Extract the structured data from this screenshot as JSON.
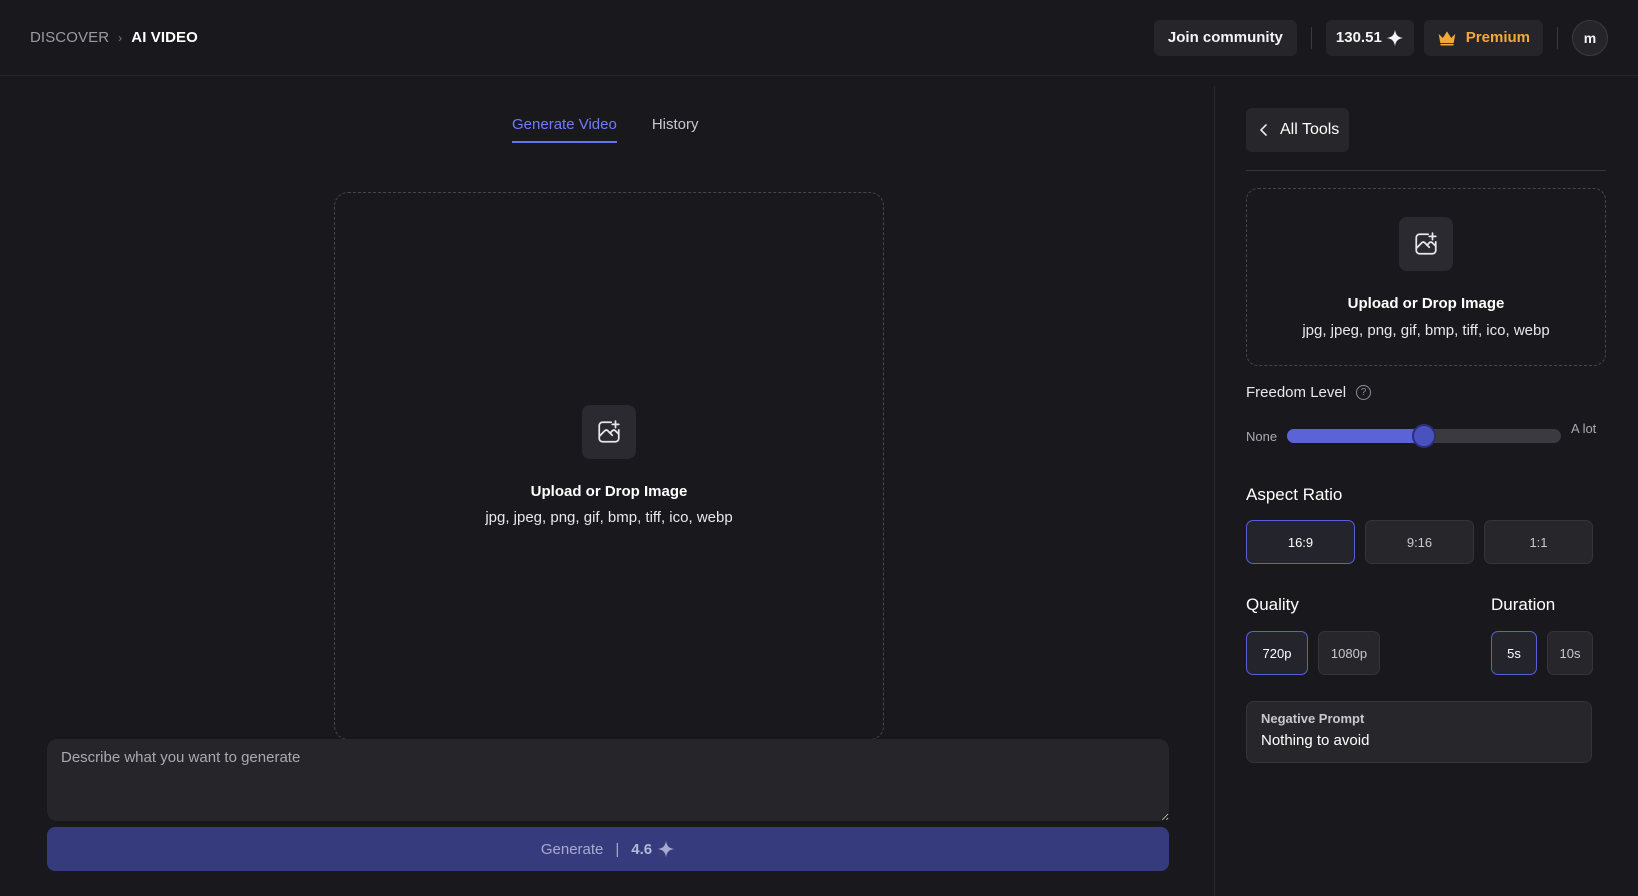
{
  "header": {
    "breadcrumb_root": "DISCOVER",
    "breadcrumb_separator": "›",
    "breadcrumb_current": "AI VIDEO",
    "join_label": "Join community",
    "credits": "130.51",
    "premium_label": "Premium",
    "avatar_initial": "m"
  },
  "tabs": [
    {
      "label": "Generate Video",
      "active": true
    },
    {
      "label": "History",
      "active": false
    }
  ],
  "upload": {
    "title": "Upload or Drop Image",
    "formats": "jpg, jpeg, png, gif, bmp, tiff, ico, webp"
  },
  "prompt": {
    "placeholder": "Describe what you want to generate",
    "value": ""
  },
  "generate": {
    "label": "Generate",
    "separator": "|",
    "cost": "4.6"
  },
  "panel": {
    "back_label": "All Tools",
    "upload_title": "Upload or Drop Image",
    "upload_formats": "jpg, jpeg, png, gif, bmp, tiff, ico, webp",
    "freedom": {
      "label": "Freedom Level",
      "help": "?",
      "min_label": "None",
      "max_label": "A lot",
      "value_fraction": 0.5
    },
    "aspect": {
      "label": "Aspect Ratio",
      "options": [
        "16:9",
        "9:16",
        "1:1"
      ],
      "selected": "16:9"
    },
    "quality": {
      "label": "Quality",
      "options": [
        "720p",
        "1080p"
      ],
      "selected": "720p"
    },
    "duration": {
      "label": "Duration",
      "options": [
        "5s",
        "10s"
      ],
      "selected": "5s"
    },
    "negative_prompt": {
      "label": "Negative Prompt",
      "value": "Nothing to avoid"
    }
  },
  "colors": {
    "accent": "#6670f0",
    "premium": "#f3a93a",
    "generate_bg": "#353b7c",
    "background": "#19191d"
  }
}
